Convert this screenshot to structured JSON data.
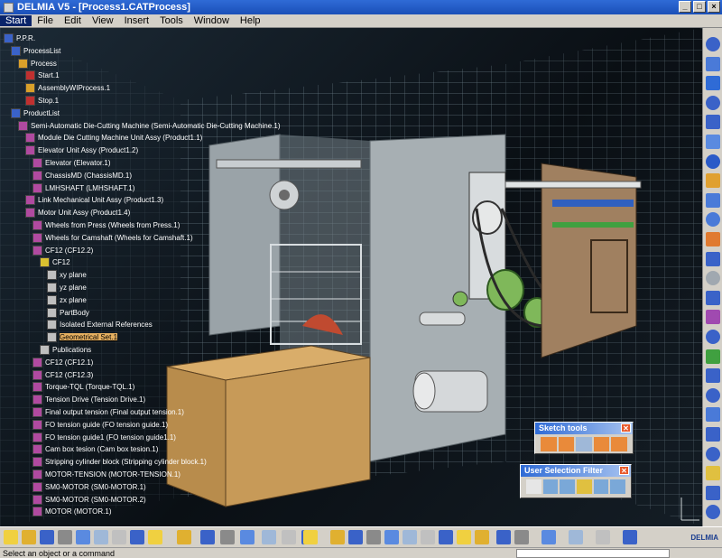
{
  "window": {
    "title": "DELMIA V5 - [Process1.CATProcess]"
  },
  "menu": [
    "Start",
    "File",
    "Edit",
    "View",
    "Insert",
    "Tools",
    "Window",
    "Help"
  ],
  "tree": [
    {
      "label": "P.P.R.",
      "depth": 0,
      "icon": "ppr-icon",
      "color": "#3a62c8"
    },
    {
      "label": "ProcessList",
      "depth": 1,
      "icon": "process-list-icon",
      "color": "#3a62c8"
    },
    {
      "label": "Process",
      "depth": 2,
      "icon": "process-icon",
      "color": "#d9a02a"
    },
    {
      "label": "Start.1",
      "depth": 3,
      "icon": "start-icon",
      "color": "#c03030"
    },
    {
      "label": "AssemblyWIProcess.1",
      "depth": 3,
      "icon": "assembly-process-icon",
      "color": "#d9a02a"
    },
    {
      "label": "Stop.1",
      "depth": 3,
      "icon": "stop-icon",
      "color": "#c03030"
    },
    {
      "label": "ProductList",
      "depth": 1,
      "icon": "product-list-icon",
      "color": "#3a62c8"
    },
    {
      "label": "Semi-Automatic Die-Cutting Machine (Semi-Automatic Die-Cutting Machine.1)",
      "depth": 2,
      "icon": "product-icon",
      "color": "#b04aa0"
    },
    {
      "label": "Module Die Cutting Machine Unit Assy (Product1.1)",
      "depth": 3,
      "icon": "product-icon",
      "color": "#b04aa0"
    },
    {
      "label": "Elevator Unit Assy (Product1.2)",
      "depth": 3,
      "icon": "product-icon",
      "color": "#b04aa0"
    },
    {
      "label": "Elevator (Elevator.1)",
      "depth": 4,
      "icon": "part-icon",
      "color": "#b04aa0"
    },
    {
      "label": "ChassisMD (ChassisMD.1)",
      "depth": 4,
      "icon": "part-icon",
      "color": "#b04aa0"
    },
    {
      "label": "LMHSHAFT (LMHSHAFT.1)",
      "depth": 4,
      "icon": "part-icon",
      "color": "#b04aa0"
    },
    {
      "label": "Link Mechanical Unit Assy (Product1.3)",
      "depth": 3,
      "icon": "product-icon",
      "color": "#b04aa0"
    },
    {
      "label": "Motor Unit Assy (Product1.4)",
      "depth": 3,
      "icon": "product-icon",
      "color": "#b04aa0"
    },
    {
      "label": "Wheels from Press (Wheels from Press.1)",
      "depth": 4,
      "icon": "part-icon",
      "color": "#b04aa0"
    },
    {
      "label": "Wheels for Camshaft (Wheels for Camshaft.1)",
      "depth": 4,
      "icon": "part-icon",
      "color": "#b04aa0"
    },
    {
      "label": "CF12 (CF12.2)",
      "depth": 4,
      "icon": "part-icon",
      "color": "#b04aa0"
    },
    {
      "label": "CF12",
      "depth": 5,
      "icon": "part-body-icon",
      "color": "#d9c030"
    },
    {
      "label": "xy plane",
      "depth": 6,
      "icon": "plane-icon",
      "color": "#bfbfbf"
    },
    {
      "label": "yz plane",
      "depth": 6,
      "icon": "plane-icon",
      "color": "#bfbfbf"
    },
    {
      "label": "zx plane",
      "depth": 6,
      "icon": "plane-icon",
      "color": "#bfbfbf"
    },
    {
      "label": "PartBody",
      "depth": 6,
      "icon": "gear-icon",
      "color": "#bfbfbf"
    },
    {
      "label": "Isolated External References",
      "depth": 6,
      "icon": "references-icon",
      "color": "#bfbfbf"
    },
    {
      "label": "Geometrical Set.1",
      "depth": 6,
      "icon": "geometrical-set-icon",
      "color": "#bfbfbf",
      "highlight": true
    },
    {
      "label": "Publications",
      "depth": 5,
      "icon": "publications-icon",
      "color": "#bfbfbf"
    },
    {
      "label": "CF12 (CF12.1)",
      "depth": 4,
      "icon": "part-icon",
      "color": "#b04aa0"
    },
    {
      "label": "CF12 (CF12.3)",
      "depth": 4,
      "icon": "part-icon",
      "color": "#b04aa0"
    },
    {
      "label": "Torque-TQL (Torque-TQL.1)",
      "depth": 4,
      "icon": "part-icon",
      "color": "#b04aa0"
    },
    {
      "label": "Tension Drive (Tension Drive.1)",
      "depth": 4,
      "icon": "part-icon",
      "color": "#b04aa0"
    },
    {
      "label": "Final output tension (Final output tension.1)",
      "depth": 4,
      "icon": "part-icon",
      "color": "#b04aa0"
    },
    {
      "label": "FO tension guide (FO tension guide.1)",
      "depth": 4,
      "icon": "part-icon",
      "color": "#b04aa0"
    },
    {
      "label": "FO tension guide1 (FO tension guide1.1)",
      "depth": 4,
      "icon": "part-icon",
      "color": "#b04aa0"
    },
    {
      "label": "Cam box tesion (Cam box tesion.1)",
      "depth": 4,
      "icon": "part-icon",
      "color": "#b04aa0"
    },
    {
      "label": "Stripping cylinder block (Stripping cylinder block.1)",
      "depth": 4,
      "icon": "part-icon",
      "color": "#b04aa0"
    },
    {
      "label": "MOTOR-TENSION (MOTOR-TENSION.1)",
      "depth": 4,
      "icon": "part-icon",
      "color": "#b04aa0"
    },
    {
      "label": "SM0-MOTOR (SM0-MOTOR.1)",
      "depth": 4,
      "icon": "part-icon",
      "color": "#b04aa0"
    },
    {
      "label": "SM0-MOTOR (SM0-MOTOR.2)",
      "depth": 4,
      "icon": "part-icon",
      "color": "#b04aa0"
    },
    {
      "label": "MOTOR (MOTOR.1)",
      "depth": 4,
      "icon": "part-icon",
      "color": "#b04aa0"
    }
  ],
  "panels": {
    "sketch_tools": {
      "title": "Sketch tools",
      "close": "✕"
    },
    "user_selection_filter": {
      "title": "User Selection Filter",
      "close": "✕"
    }
  },
  "brand": "DELMIA",
  "status": {
    "text": "Select an object or a command"
  },
  "colors": {
    "title_bar": "#1a4fb8",
    "grid": "#8fa3ad",
    "chrome": "#d4d0c8",
    "box": "#c79a58"
  }
}
